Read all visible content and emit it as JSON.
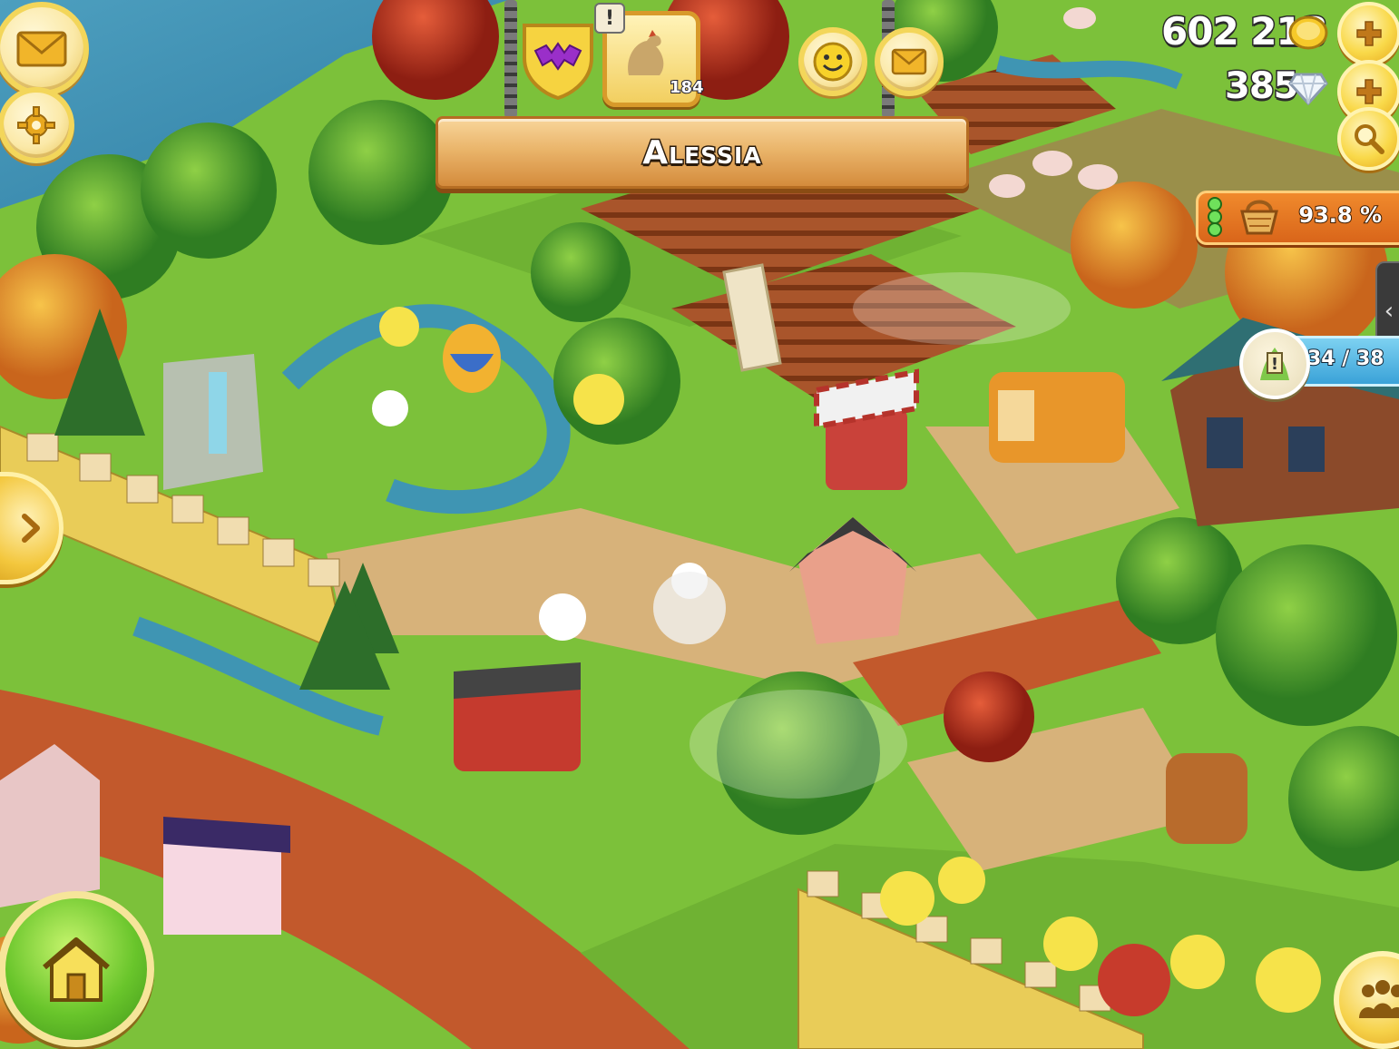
{
  "hud": {
    "player_name": "Alessia",
    "coins": "602 213",
    "diamonds": "385",
    "level": "184",
    "basket_percent": "93.8 %",
    "quest_progress": "34 / 38"
  },
  "colors": {
    "coin_plus": "#f9d94a",
    "home_button": "#69c52b",
    "basket_bar": "#e5741f",
    "quest_bar": "#3aa2d8",
    "water": "#3f95b3",
    "grass": "#7cc13a",
    "dirt_road": "#c2592c"
  },
  "icons": {
    "mail": "envelope-icon",
    "settings": "gear-icon",
    "emote": "smiley-icon",
    "neighbor_mail": "envelope-icon",
    "add": "plus-icon",
    "search": "magnifier-icon",
    "home": "house-icon",
    "friends": "people-icon",
    "expand": "chevron-right-icon",
    "side": "chevron-left-icon",
    "coin": "coin-icon",
    "diamond": "diamond-icon",
    "basket": "basket-icon",
    "rooster": "rooster-icon",
    "bat_shield": "bat-shield-icon"
  }
}
